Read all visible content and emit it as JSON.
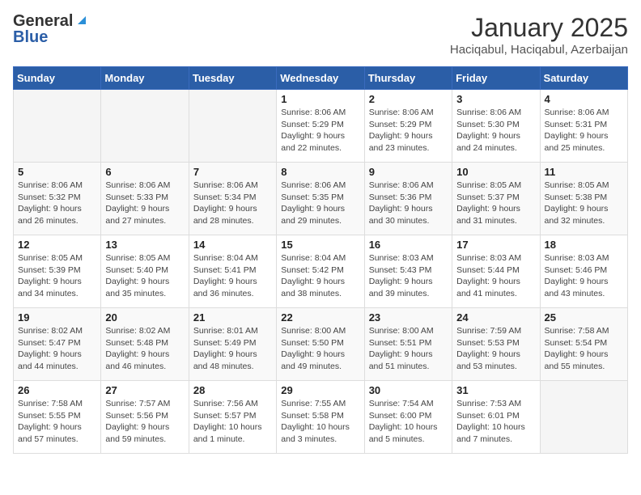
{
  "header": {
    "logo_general": "General",
    "logo_blue": "Blue",
    "title": "January 2025",
    "subtitle": "Haciqabul, Haciqabul, Azerbaijan"
  },
  "weekdays": [
    "Sunday",
    "Monday",
    "Tuesday",
    "Wednesday",
    "Thursday",
    "Friday",
    "Saturday"
  ],
  "weeks": [
    [
      {
        "day": "",
        "sunrise": "",
        "sunset": "",
        "daylight": ""
      },
      {
        "day": "",
        "sunrise": "",
        "sunset": "",
        "daylight": ""
      },
      {
        "day": "",
        "sunrise": "",
        "sunset": "",
        "daylight": ""
      },
      {
        "day": "1",
        "sunrise": "Sunrise: 8:06 AM",
        "sunset": "Sunset: 5:29 PM",
        "daylight": "Daylight: 9 hours and 22 minutes."
      },
      {
        "day": "2",
        "sunrise": "Sunrise: 8:06 AM",
        "sunset": "Sunset: 5:29 PM",
        "daylight": "Daylight: 9 hours and 23 minutes."
      },
      {
        "day": "3",
        "sunrise": "Sunrise: 8:06 AM",
        "sunset": "Sunset: 5:30 PM",
        "daylight": "Daylight: 9 hours and 24 minutes."
      },
      {
        "day": "4",
        "sunrise": "Sunrise: 8:06 AM",
        "sunset": "Sunset: 5:31 PM",
        "daylight": "Daylight: 9 hours and 25 minutes."
      }
    ],
    [
      {
        "day": "5",
        "sunrise": "Sunrise: 8:06 AM",
        "sunset": "Sunset: 5:32 PM",
        "daylight": "Daylight: 9 hours and 26 minutes."
      },
      {
        "day": "6",
        "sunrise": "Sunrise: 8:06 AM",
        "sunset": "Sunset: 5:33 PM",
        "daylight": "Daylight: 9 hours and 27 minutes."
      },
      {
        "day": "7",
        "sunrise": "Sunrise: 8:06 AM",
        "sunset": "Sunset: 5:34 PM",
        "daylight": "Daylight: 9 hours and 28 minutes."
      },
      {
        "day": "8",
        "sunrise": "Sunrise: 8:06 AM",
        "sunset": "Sunset: 5:35 PM",
        "daylight": "Daylight: 9 hours and 29 minutes."
      },
      {
        "day": "9",
        "sunrise": "Sunrise: 8:06 AM",
        "sunset": "Sunset: 5:36 PM",
        "daylight": "Daylight: 9 hours and 30 minutes."
      },
      {
        "day": "10",
        "sunrise": "Sunrise: 8:05 AM",
        "sunset": "Sunset: 5:37 PM",
        "daylight": "Daylight: 9 hours and 31 minutes."
      },
      {
        "day": "11",
        "sunrise": "Sunrise: 8:05 AM",
        "sunset": "Sunset: 5:38 PM",
        "daylight": "Daylight: 9 hours and 32 minutes."
      }
    ],
    [
      {
        "day": "12",
        "sunrise": "Sunrise: 8:05 AM",
        "sunset": "Sunset: 5:39 PM",
        "daylight": "Daylight: 9 hours and 34 minutes."
      },
      {
        "day": "13",
        "sunrise": "Sunrise: 8:05 AM",
        "sunset": "Sunset: 5:40 PM",
        "daylight": "Daylight: 9 hours and 35 minutes."
      },
      {
        "day": "14",
        "sunrise": "Sunrise: 8:04 AM",
        "sunset": "Sunset: 5:41 PM",
        "daylight": "Daylight: 9 hours and 36 minutes."
      },
      {
        "day": "15",
        "sunrise": "Sunrise: 8:04 AM",
        "sunset": "Sunset: 5:42 PM",
        "daylight": "Daylight: 9 hours and 38 minutes."
      },
      {
        "day": "16",
        "sunrise": "Sunrise: 8:03 AM",
        "sunset": "Sunset: 5:43 PM",
        "daylight": "Daylight: 9 hours and 39 minutes."
      },
      {
        "day": "17",
        "sunrise": "Sunrise: 8:03 AM",
        "sunset": "Sunset: 5:44 PM",
        "daylight": "Daylight: 9 hours and 41 minutes."
      },
      {
        "day": "18",
        "sunrise": "Sunrise: 8:03 AM",
        "sunset": "Sunset: 5:46 PM",
        "daylight": "Daylight: 9 hours and 43 minutes."
      }
    ],
    [
      {
        "day": "19",
        "sunrise": "Sunrise: 8:02 AM",
        "sunset": "Sunset: 5:47 PM",
        "daylight": "Daylight: 9 hours and 44 minutes."
      },
      {
        "day": "20",
        "sunrise": "Sunrise: 8:02 AM",
        "sunset": "Sunset: 5:48 PM",
        "daylight": "Daylight: 9 hours and 46 minutes."
      },
      {
        "day": "21",
        "sunrise": "Sunrise: 8:01 AM",
        "sunset": "Sunset: 5:49 PM",
        "daylight": "Daylight: 9 hours and 48 minutes."
      },
      {
        "day": "22",
        "sunrise": "Sunrise: 8:00 AM",
        "sunset": "Sunset: 5:50 PM",
        "daylight": "Daylight: 9 hours and 49 minutes."
      },
      {
        "day": "23",
        "sunrise": "Sunrise: 8:00 AM",
        "sunset": "Sunset: 5:51 PM",
        "daylight": "Daylight: 9 hours and 51 minutes."
      },
      {
        "day": "24",
        "sunrise": "Sunrise: 7:59 AM",
        "sunset": "Sunset: 5:53 PM",
        "daylight": "Daylight: 9 hours and 53 minutes."
      },
      {
        "day": "25",
        "sunrise": "Sunrise: 7:58 AM",
        "sunset": "Sunset: 5:54 PM",
        "daylight": "Daylight: 9 hours and 55 minutes."
      }
    ],
    [
      {
        "day": "26",
        "sunrise": "Sunrise: 7:58 AM",
        "sunset": "Sunset: 5:55 PM",
        "daylight": "Daylight: 9 hours and 57 minutes."
      },
      {
        "day": "27",
        "sunrise": "Sunrise: 7:57 AM",
        "sunset": "Sunset: 5:56 PM",
        "daylight": "Daylight: 9 hours and 59 minutes."
      },
      {
        "day": "28",
        "sunrise": "Sunrise: 7:56 AM",
        "sunset": "Sunset: 5:57 PM",
        "daylight": "Daylight: 10 hours and 1 minute."
      },
      {
        "day": "29",
        "sunrise": "Sunrise: 7:55 AM",
        "sunset": "Sunset: 5:58 PM",
        "daylight": "Daylight: 10 hours and 3 minutes."
      },
      {
        "day": "30",
        "sunrise": "Sunrise: 7:54 AM",
        "sunset": "Sunset: 6:00 PM",
        "daylight": "Daylight: 10 hours and 5 minutes."
      },
      {
        "day": "31",
        "sunrise": "Sunrise: 7:53 AM",
        "sunset": "Sunset: 6:01 PM",
        "daylight": "Daylight: 10 hours and 7 minutes."
      },
      {
        "day": "",
        "sunrise": "",
        "sunset": "",
        "daylight": ""
      }
    ]
  ]
}
